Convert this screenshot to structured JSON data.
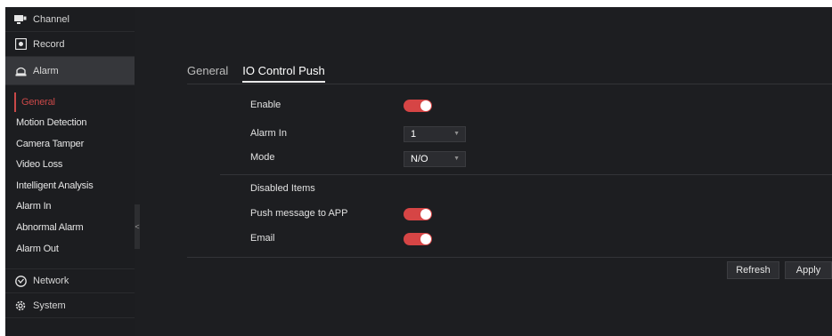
{
  "sidebar": {
    "top_items": [
      {
        "label": "Channel",
        "icon": "monitor-icon"
      },
      {
        "label": "Record",
        "icon": "record-icon"
      },
      {
        "label": "Alarm",
        "icon": "alarm-icon"
      }
    ],
    "sub_items": [
      {
        "label": "General",
        "selected": true
      },
      {
        "label": "Motion Detection"
      },
      {
        "label": "Camera Tamper"
      },
      {
        "label": "Video Loss"
      },
      {
        "label": "Intelligent Analysis"
      },
      {
        "label": "Alarm In"
      },
      {
        "label": "Abnormal Alarm"
      },
      {
        "label": "Alarm Out"
      }
    ],
    "bottom_items": [
      {
        "label": "Network",
        "icon": "network-icon"
      },
      {
        "label": "System",
        "icon": "system-gear-icon"
      }
    ],
    "collapse_glyph": "<"
  },
  "tabs": [
    {
      "label": "General"
    },
    {
      "label": "IO Control Push",
      "active": true
    }
  ],
  "form": {
    "enable_label": "Enable",
    "enable_on": true,
    "alarm_in_label": "Alarm In",
    "alarm_in_value": "1",
    "mode_label": "Mode",
    "mode_value": "N/O",
    "disabled_items_label": "Disabled Items",
    "push_label": "Push message to APP",
    "push_on": true,
    "email_label": "Email",
    "email_on": true
  },
  "buttons": {
    "refresh": "Refresh",
    "apply": "Apply"
  },
  "colors": {
    "accent": "#d64545",
    "background": "#1d1e21",
    "sidebar_active": "#36373b"
  }
}
